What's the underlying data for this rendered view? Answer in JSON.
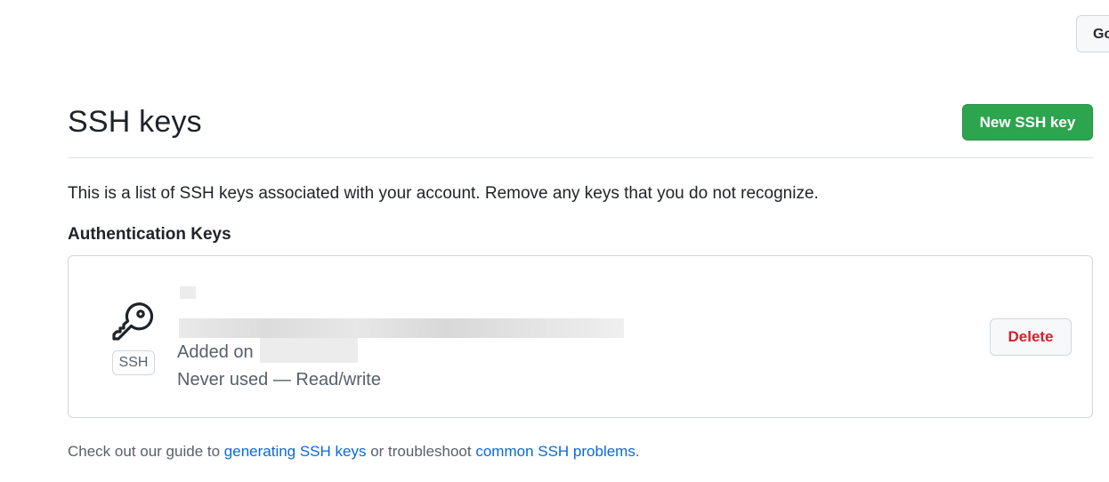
{
  "header": {
    "partial_button_label": "Go"
  },
  "page": {
    "title": "SSH keys",
    "new_key_label": "New SSH key",
    "intro": "This is a list of SSH keys associated with your account. Remove any keys that you do not recognize.",
    "section_title": "Authentication Keys"
  },
  "key": {
    "icon": "key-icon",
    "badge": "SSH",
    "added_label": "Added on",
    "usage": "Never used — Read/write",
    "delete_label": "Delete"
  },
  "footer": {
    "prefix": "Check out our guide to ",
    "link1": "generating SSH keys",
    "middle": " or troubleshoot ",
    "link2": "common SSH problems",
    "suffix": "."
  },
  "colors": {
    "primary_button": "#2da44e",
    "danger_text": "#cf222e",
    "link": "#0969da"
  }
}
